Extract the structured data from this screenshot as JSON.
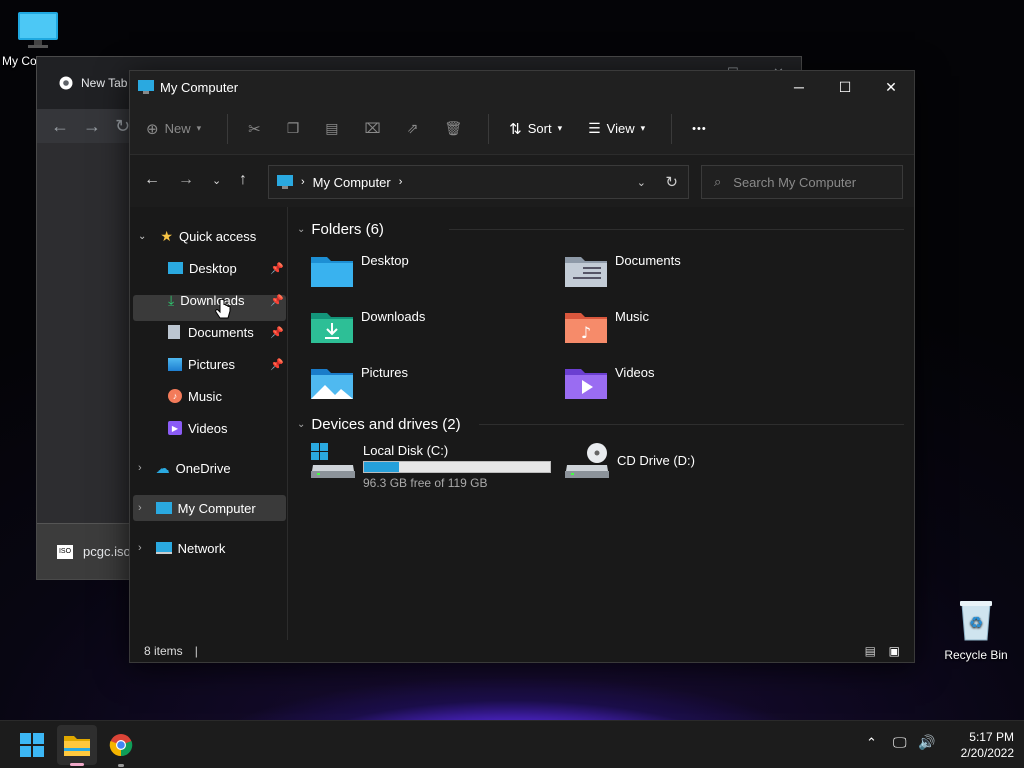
{
  "desktop": {
    "my_computer_label": "My Co",
    "recycle_bin_label": "Recycle Bin"
  },
  "chrome": {
    "tab_title": "New Tab",
    "download_file": "pcgc.iso"
  },
  "explorer": {
    "title": "My Computer",
    "commands": {
      "new": "New",
      "sort": "Sort",
      "view": "View",
      "more": "•••"
    },
    "address": {
      "path": "My Computer"
    },
    "search": {
      "placeholder": "Search My Computer"
    },
    "sidebar": {
      "quick_access": "Quick access",
      "items": [
        {
          "label": "Desktop",
          "pinned": true
        },
        {
          "label": "Downloads",
          "pinned": true
        },
        {
          "label": "Documents",
          "pinned": true
        },
        {
          "label": "Pictures",
          "pinned": true
        },
        {
          "label": "Music",
          "pinned": false
        },
        {
          "label": "Videos",
          "pinned": false
        }
      ],
      "onedrive": "OneDrive",
      "my_computer": "My Computer",
      "network": "Network"
    },
    "folders_header": "Folders (6)",
    "folders": [
      "Desktop",
      "Documents",
      "Downloads",
      "Music",
      "Pictures",
      "Videos"
    ],
    "drives_header": "Devices and drives (2)",
    "drives": [
      {
        "name": "Local Disk (C:)",
        "free": "96.3 GB free of 119 GB",
        "used_fraction": 0.19
      },
      {
        "name": "CD Drive (D:)"
      }
    ],
    "status": {
      "count": "8 items"
    }
  },
  "taskbar": {
    "time": "5:17 PM",
    "date": "2/20/2022"
  },
  "colors": {
    "accent": "#0ea5e9",
    "bar_fill": "#26a0da"
  }
}
